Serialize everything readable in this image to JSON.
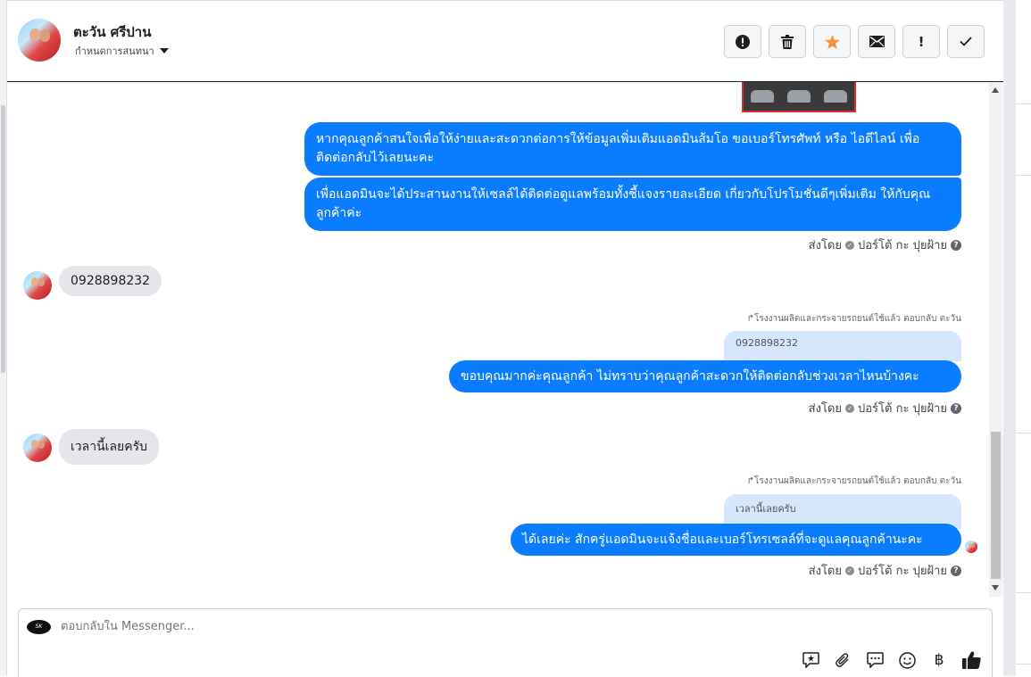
{
  "header": {
    "contact_name": "ตะวัน ศรีปาน",
    "assign_label": "กำหนดการสนทนา",
    "toolbar": {
      "spam_icon": "alert-circle-icon",
      "delete_icon": "trash-icon",
      "star_icon": "star-icon",
      "mail_icon": "envelope-icon",
      "important_icon": "exclamation-icon",
      "done_icon": "check-icon",
      "star_color": "#f7923b"
    }
  },
  "messages": {
    "out_1": "หากคุณลูกค้าสนใจเพื่อให้ง่ายและสะดวกต่อการให้ข้อมูลเพิ่มเติมแอดมินส้มโอ ขอเบอร์โทรศัพท์ หรือ ไอดีไลน์ เพื่อติดต่อกลับไว้เลยนะคะ",
    "out_2": "เพื่อแอดมินจะได้ประสานงานให้เซลล์ได้ติดต่อดูแลพร้อมทั้งชี้แจงรายละเอียด เกี่ยวกับโปรโมชั่นดีๆเพิ่มเติม ให้กับคุณลูกค้าค่ะ",
    "sent_by_1": "ส่งโดย",
    "sent_by_name_1": "ปอร์โต้ กะ ปุยฝ้าย",
    "in_1": "0928898232",
    "reply_note_1": "โรงงานผลิตและกระจายรถยนต์ใช้แล้ว ตอบกลับ ตะวัน",
    "quoted_1": "0928898232",
    "out_3": "ขอบคุณมากค่ะคุณลูกค้า ไม่ทราบว่าคุณลูกค้าสะดวกให้ติดต่อกลับช่วงเวลาไหนบ้างคะ",
    "sent_by_2": "ส่งโดย",
    "sent_by_name_2": "ปอร์โต้ กะ ปุยฝ้าย",
    "in_2": "เวลานี้เลยครับ",
    "reply_note_2": "โรงงานผลิตและกระจายรถยนต์ใช้แล้ว ตอบกลับ ตะวัน",
    "quoted_2": "เวลานี้เลยครับ",
    "out_4": "ได้เลยค่ะ สักครู่แอดมินจะแจ้งชื่อและเบอร์โทรเซลล์ที่จะดูแลคุณลูกค้านะคะ",
    "sent_by_3": "ส่งโดย",
    "sent_by_name_3": "ปอร์โต้ กะ ปุยฝ้าย",
    "bubble_color": "#0a7cff",
    "incoming_color": "#e4e6eb"
  },
  "composer": {
    "placeholder": "ตอบกลับใน Messenger...",
    "tools": [
      "saved-reply-icon",
      "attachment-icon",
      "comment-icon",
      "emoji-icon",
      "baht-icon",
      "like-icon"
    ],
    "baht_symbol": "฿"
  }
}
